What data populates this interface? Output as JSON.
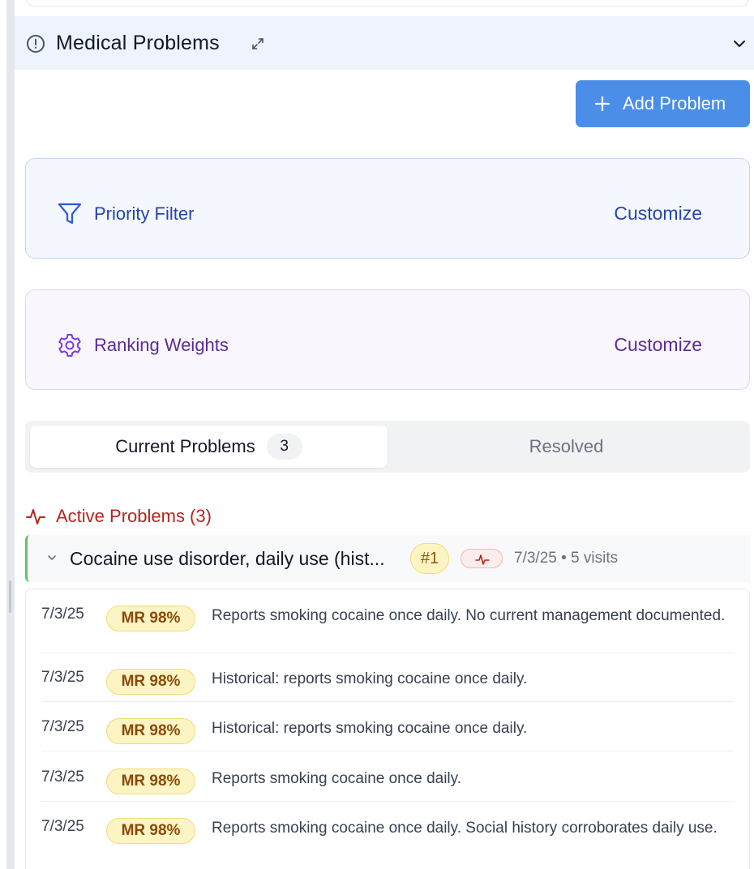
{
  "section": {
    "title": "Medical Problems",
    "add_button_label": "Add Problem"
  },
  "filters": {
    "priority": {
      "label": "Priority Filter",
      "action": "Customize"
    },
    "ranking": {
      "label": "Ranking Weights",
      "action": "Customize"
    }
  },
  "tabs": {
    "current_label": "Current Problems",
    "current_count": "3",
    "resolved_label": "Resolved"
  },
  "active": {
    "heading": "Active Problems (3)"
  },
  "problem": {
    "name": "Cocaine use disorder, daily use (hist...",
    "rank": "#1",
    "meta": "7/3/25 • 5 visits"
  },
  "notes": [
    {
      "date": "7/3/25",
      "badge": "MR 98%",
      "text": "Reports smoking cocaine once daily. No current management documented."
    },
    {
      "date": "7/3/25",
      "badge": "MR 98%",
      "text": "Historical: reports smoking cocaine once daily."
    },
    {
      "date": "7/3/25",
      "badge": "MR 98%",
      "text": "Historical: reports smoking cocaine once daily."
    },
    {
      "date": "7/3/25",
      "badge": "MR 98%",
      "text": "Reports smoking cocaine once daily."
    },
    {
      "date": "7/3/25",
      "badge": "MR 98%",
      "text": "Reports smoking cocaine once daily. Social history corroborates daily use."
    }
  ],
  "colors": {
    "header_bg": "#eef3fd",
    "primary_button": "#4a8ee8",
    "priority_accent": "#2446a8",
    "ranking_accent": "#5b2b96",
    "active_red": "#b3261e",
    "badge_yellow": "#fdf4c4"
  },
  "icons": {
    "header": "alert-circle-icon",
    "expand": "expand-arrows-icon",
    "collapse": "chevron-down-icon",
    "add": "plus-icon",
    "priority": "filter-icon",
    "ranking": "gear-icon",
    "active": "pulse-icon"
  }
}
